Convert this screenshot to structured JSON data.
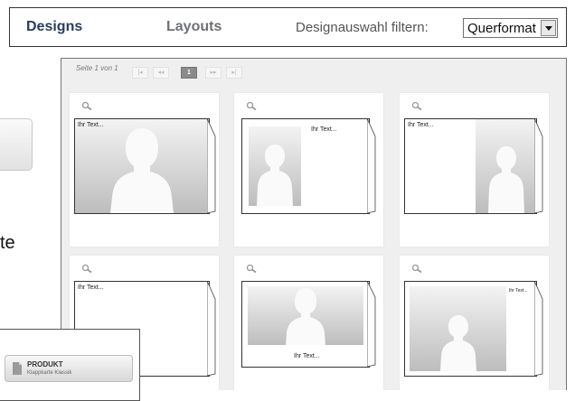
{
  "tabs": [
    {
      "label": "Designs"
    },
    {
      "label": "Layouts"
    }
  ],
  "filter": {
    "label": "Designauswahl filtern:",
    "selected": "Querformat"
  },
  "side_text": "te",
  "pager": {
    "info": "Seite 1 von 1",
    "first": "|◂",
    "prev": "◂◂",
    "current": "1",
    "next": "▸▸",
    "last": "▸|"
  },
  "cards": [
    {
      "text": "Ihr Text..."
    },
    {
      "text": "Ihr Text..."
    },
    {
      "text": "Ihr Text..."
    },
    {
      "text": "Ihr Text..."
    },
    {
      "text": "Ihr Text..."
    },
    {
      "text": "Ihr Text..."
    }
  ],
  "product": {
    "title": "PRODUKT",
    "subtitle": "Klappkarte Klassik"
  },
  "colors": {
    "tab_active": "#2a3d5e",
    "tab_inactive": "#6f7077",
    "panel_bg": "#efefef"
  }
}
